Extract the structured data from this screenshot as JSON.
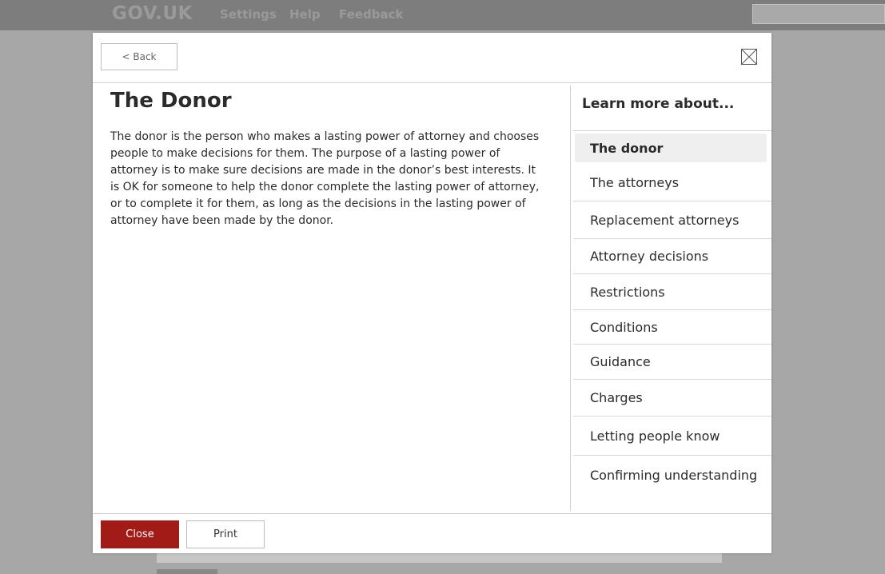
{
  "header": {
    "logo": "GOV.UK",
    "nav": [
      "Settings",
      "Help",
      "Feedback"
    ]
  },
  "modal": {
    "back_label": "< Back",
    "close_icon": "close-box-icon",
    "title": "The Donor",
    "body": "The donor is the person who makes a lasting power of attorney and chooses people to make decisions for them. The purpose of a lasting power of attorney is to make sure decisions are made in the donor’s best interests. It is OK for someone to help the donor complete the lasting power of attorney, or to complete it for them, as long as the decisions in the lasting power of attorney have been made by the donor.",
    "aside_title": "Learn more about...",
    "topics": [
      "The donor",
      "The attorneys",
      "Replacement attorneys",
      "Attorney decisions",
      "Restrictions",
      "Conditions",
      "Guidance",
      "Charges",
      "Letting people know",
      "Confirming understanding"
    ],
    "active_topic": "The donor",
    "footer": {
      "close_label": "Close",
      "print_label": "Print"
    }
  },
  "colors": {
    "close_button": "#a31b16",
    "overlay": "#a7a7a7",
    "topbar": "#7d7d7d"
  }
}
